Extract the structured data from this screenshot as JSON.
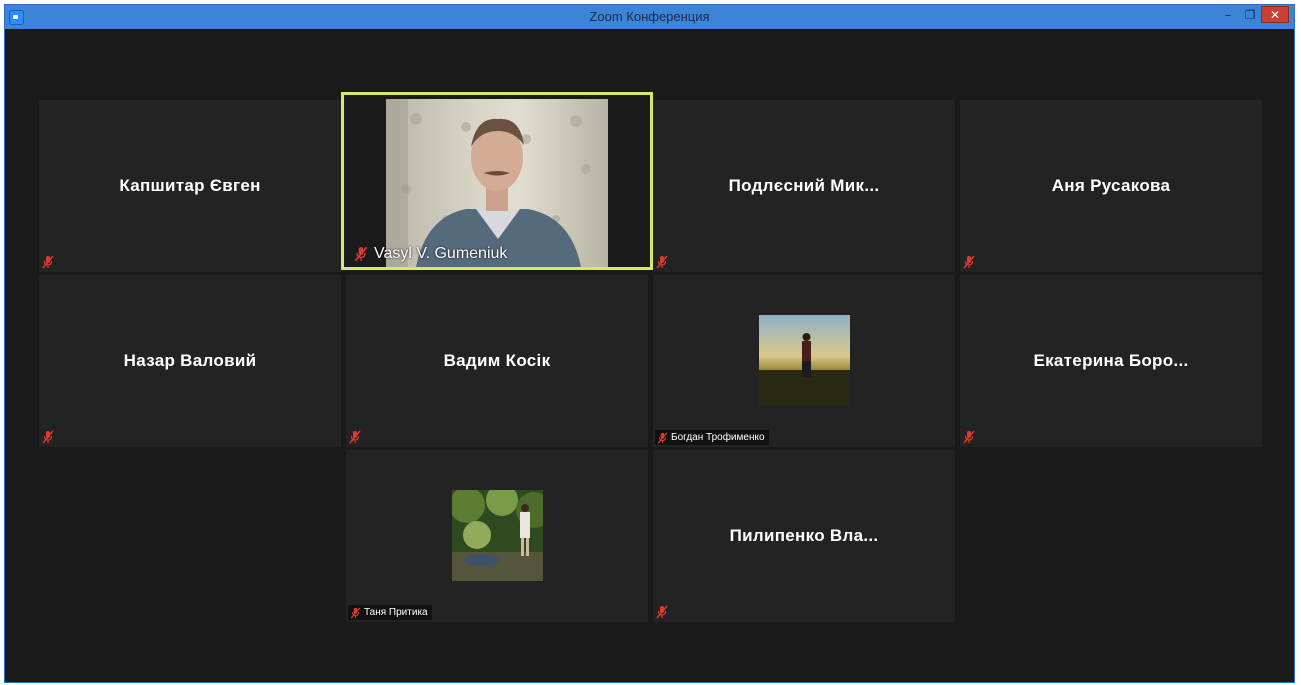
{
  "window": {
    "title": "Zoom Конференция",
    "minimize_glyph": "–",
    "restore_glyph": "❐",
    "close_glyph": "✕"
  },
  "colors": {
    "background": "#1a1a1a",
    "tile": "#232323",
    "active_speaker_border": "#d6ea6a",
    "muted_icon": "#e03a2f",
    "titlebar": "#3c84d6"
  },
  "participants": [
    {
      "name": "Капшитар Євген",
      "muted": true,
      "display": "name"
    },
    {
      "name": "Vasyl V. Gumeniuk",
      "muted": true,
      "display": "video",
      "active_speaker": true
    },
    {
      "name": "Подлєсний Мик...",
      "muted": true,
      "display": "name"
    },
    {
      "name": "Аня Русакова",
      "muted": true,
      "display": "name"
    },
    {
      "name": "Назар Валовий",
      "muted": true,
      "display": "name"
    },
    {
      "name": "Вадим Косік",
      "muted": true,
      "display": "name"
    },
    {
      "name": "Богдан Трофименко",
      "muted": true,
      "display": "avatar"
    },
    {
      "name": "Екатерина  Боро...",
      "muted": true,
      "display": "name"
    },
    {
      "name": "Таня Притика",
      "muted": true,
      "display": "avatar"
    },
    {
      "name": "Пилипенко  Вла...",
      "muted": true,
      "display": "name"
    }
  ],
  "icons": {
    "muted": "muted-mic-icon",
    "app": "zoom-app-icon"
  }
}
